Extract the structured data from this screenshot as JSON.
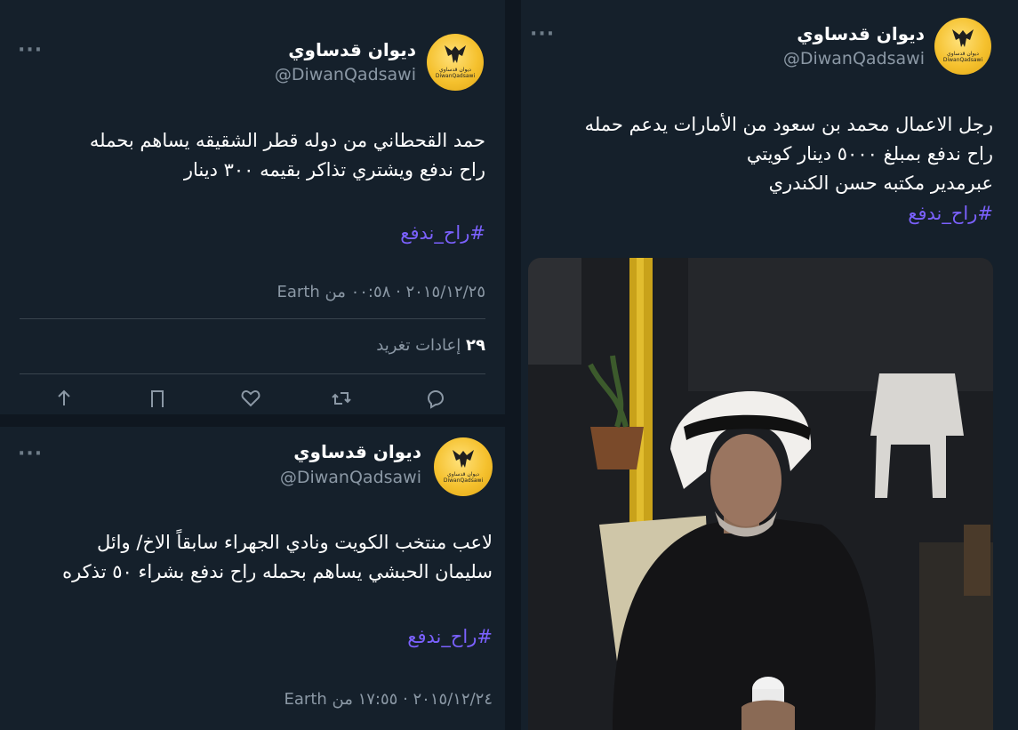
{
  "tweets": [
    {
      "name": "ديوان قدساوي",
      "handle": "@DiwanQadsawi",
      "line1": "حمد القحطاني من دوله قطر الشقيقه يساهم بحمله",
      "line2": "راح ندفع ويشتري تذاكر بقيمه ٣٠٠ دينار",
      "hashtag": "#راح_ندفع",
      "meta": "٢٠١٥/١٢/٢٥ · ‏٠٠:٥٨ من Earth",
      "retweets_count": "٢٩",
      "retweets_label": "إعادات تغريد"
    },
    {
      "name": "ديوان قدساوي",
      "handle": "@DiwanQadsawi",
      "line1": "لاعب منتخب الكويت ونادي الجهراء سابقاً الاخ/ وائل",
      "line2": "سليمان الحبشي يساهم بحمله راح ندفع بشراء ٥٠ تذكره",
      "hashtag": "#راح_ندفع",
      "meta": "٢٠١٥/١٢/٢٤ · ‏١٧:٥٥ من Earth"
    },
    {
      "name": "ديوان قدساوي",
      "handle": "@DiwanQadsawi",
      "line1": "رجل الاعمال محمد بن سعود من الأمارات يدعم حمله",
      "line2": "راح ندفع بمبلغ ٥٠٠٠ دينار كويتي",
      "line3": "عبرمدير مكتبه حسن الكندري",
      "hashtag": "#راح_ندفع"
    }
  ],
  "avatar_text": "ديوان قدساوي\nDiwanQadsawi",
  "icons": [
    "more-icon",
    "reply-icon",
    "retweet-icon",
    "like-icon",
    "bookmark-icon",
    "share-icon"
  ],
  "colors": {
    "background": "#15202b",
    "link": "#7b61ff",
    "muted": "#8b98a5",
    "accent": "#f5c12e"
  }
}
